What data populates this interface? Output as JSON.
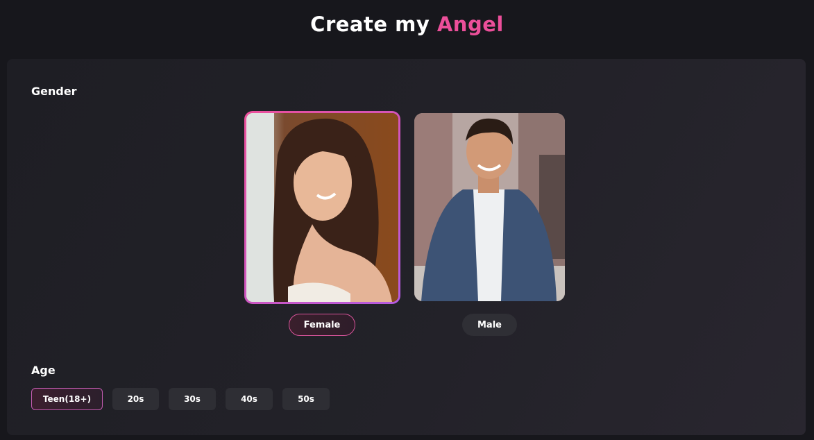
{
  "header": {
    "title_prefix": "Create my",
    "title_accent": "Angel"
  },
  "gender": {
    "label": "Gender",
    "options": [
      {
        "label": "Female",
        "selected": true,
        "image": "portrait-woman"
      },
      {
        "label": "Male",
        "selected": false,
        "image": "portrait-man"
      }
    ]
  },
  "age": {
    "label": "Age",
    "options": [
      {
        "label": "Teen(18+)",
        "selected": true
      },
      {
        "label": "20s",
        "selected": false
      },
      {
        "label": "30s",
        "selected": false
      },
      {
        "label": "40s",
        "selected": false
      },
      {
        "label": "50s",
        "selected": false
      }
    ]
  },
  "colors": {
    "accent": "#ec4f9a",
    "accent2": "#b45be0",
    "background": "#17171c",
    "panel": "#222228"
  }
}
